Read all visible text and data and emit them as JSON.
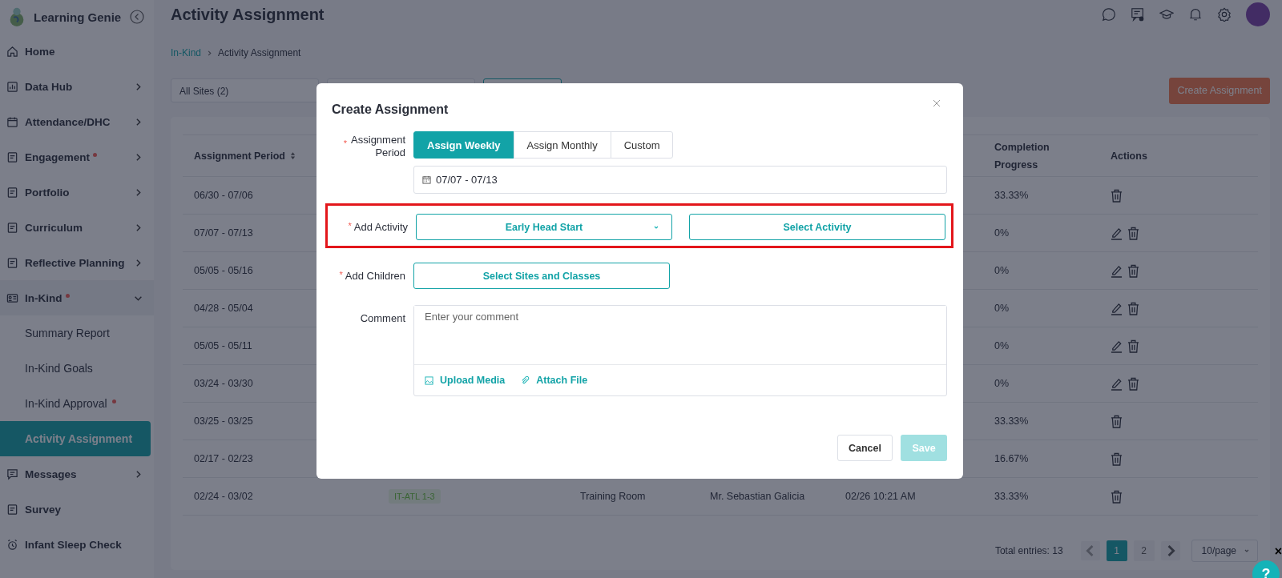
{
  "app": {
    "name": "Learning Genie"
  },
  "sidebar": {
    "items": [
      {
        "label": "Home",
        "dot": false,
        "selected": false
      },
      {
        "label": "Data Hub",
        "dot": false,
        "expanded": false,
        "selected": false
      },
      {
        "label": "Attendance/DHC",
        "dot": false,
        "expanded": false,
        "selected": false
      },
      {
        "label": "Engagement",
        "dot": true,
        "expanded": false,
        "selected": false
      },
      {
        "label": "Portfolio",
        "dot": false,
        "expanded": false,
        "selected": false
      },
      {
        "label": "Curriculum",
        "dot": false,
        "expanded": false,
        "selected": false
      },
      {
        "label": "Reflective Planning",
        "dot": false,
        "expanded": false,
        "selected": false
      },
      {
        "label": "In-Kind",
        "dot": true,
        "expanded": true,
        "selected": false,
        "children": [
          {
            "label": "Summary Report",
            "dot": false,
            "selected": false
          },
          {
            "label": "In-Kind Goals",
            "dot": false,
            "selected": false
          },
          {
            "label": "In-Kind Approval",
            "dot": true,
            "selected": false
          },
          {
            "label": "Activity Assignment",
            "dot": false,
            "selected": true
          }
        ]
      },
      {
        "label": "Messages",
        "dot": false,
        "expanded": false,
        "selected": false
      },
      {
        "label": "Survey",
        "dot": false,
        "selected": false
      },
      {
        "label": "Infant Sleep Check",
        "dot": false,
        "selected": false
      }
    ]
  },
  "header": {
    "title": "Activity Assignment"
  },
  "breadcrumb": [
    "In-Kind",
    "Activity Assignment"
  ],
  "filters": {
    "sites": "All Sites (2)"
  },
  "create_button": "Create Assignment",
  "table": {
    "columns": [
      "Assignment Period",
      "",
      "",
      "",
      "",
      "Completion Progress",
      "Actions"
    ],
    "rows": [
      {
        "period": "06/30 - 07/06",
        "progress": "33.33%",
        "editable": false
      },
      {
        "period": "07/07 - 07/13",
        "progress": "0%",
        "editable": true
      },
      {
        "period": "05/05 - 05/16",
        "progress": "0%",
        "editable": true
      },
      {
        "period": "04/28 - 05/04",
        "progress": "0%",
        "editable": true
      },
      {
        "period": "05/05 - 05/11",
        "progress": "0%",
        "editable": true
      },
      {
        "period": "03/24 - 03/30",
        "progress": "0%",
        "editable": true
      },
      {
        "period": "03/25 - 03/25",
        "progress": "33.33%",
        "editable": false
      },
      {
        "period": "02/17 - 02/23",
        "progress": "16.67%",
        "editable": false
      },
      {
        "period": "02/24 - 03/02",
        "tag": "IT-ATL 1-3",
        "room": "Training Room",
        "creator": "Mr. Sebastian Galicia",
        "time": "02/26 10:21 AM",
        "progress": "33.33%",
        "editable": false
      }
    ]
  },
  "pagination": {
    "total": "Total entries: 13",
    "pages": [
      {
        "label": "1",
        "selected": true
      },
      {
        "label": "2",
        "selected": false
      }
    ],
    "page_size": "10/page"
  },
  "modal": {
    "title": "Create Assignment",
    "required_mark": "*",
    "period_label": "Assignment Period",
    "period_required": true,
    "period_options": [
      {
        "label": "Assign Weekly",
        "selected": true
      },
      {
        "label": "Assign Monthly",
        "selected": false
      },
      {
        "label": "Custom",
        "selected": false
      }
    ],
    "date_range": "07/07 - 07/13",
    "activity_label": "Add Activity",
    "activity_required": true,
    "activity_highlighted": true,
    "program": "Early Head Start",
    "select_activity": "Select Activity",
    "children_label": "Add Children",
    "children_required": true,
    "select_children": "Select Sites and Classes",
    "comment_label": "Comment",
    "comment_placeholder": "Enter your comment",
    "upload_media": "Upload Media",
    "attach_file": "Attach File",
    "cancel": "Cancel",
    "save": "Save",
    "save_disabled": true
  },
  "help_button": "?",
  "help_close": "×"
}
